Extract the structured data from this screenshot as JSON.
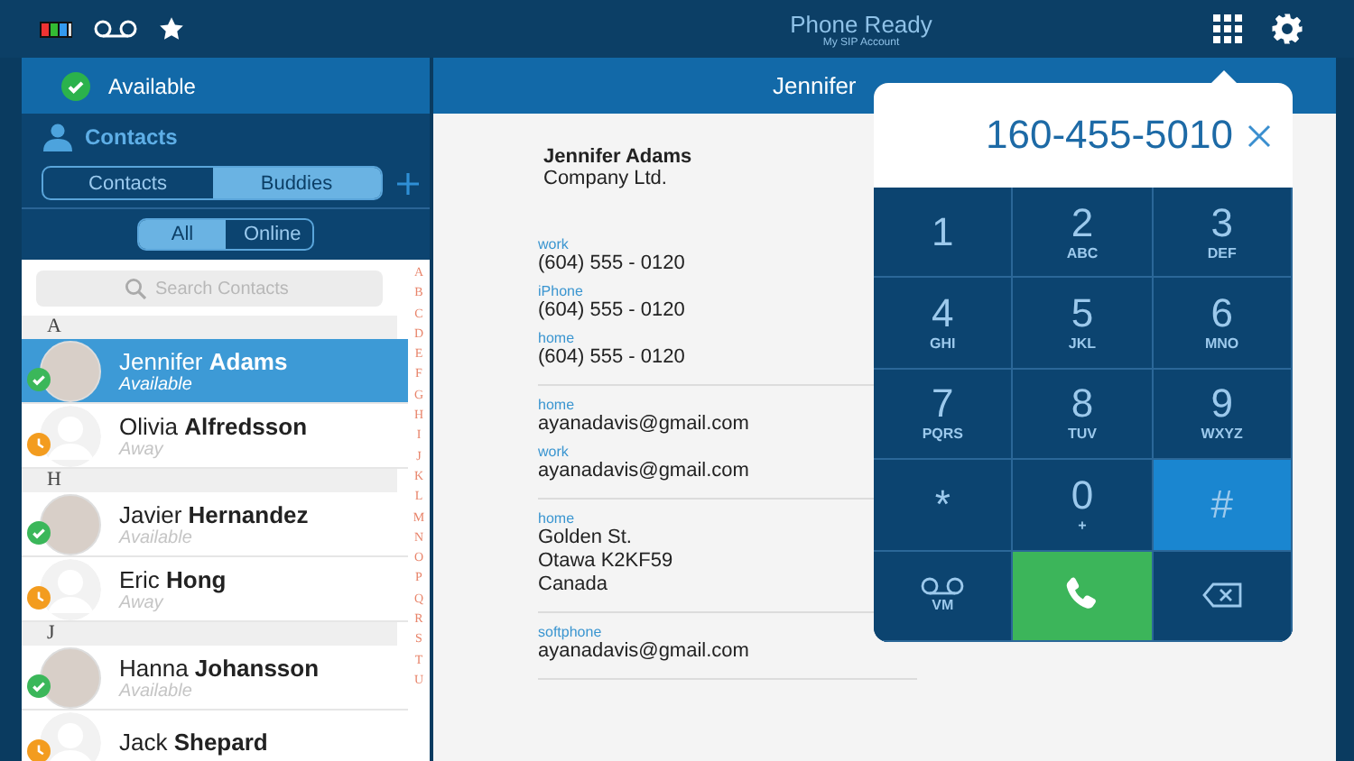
{
  "top_bar": {
    "title": "Phone Ready",
    "subtitle": "My SIP Account"
  },
  "presence": {
    "label": "Available",
    "online": true
  },
  "sidebar": {
    "heading": "Contacts",
    "source_tabs": [
      {
        "label": "Contacts",
        "selected": false
      },
      {
        "label": "Buddies",
        "selected": true
      }
    ],
    "filter_tabs": [
      {
        "label": "All",
        "selected": true
      },
      {
        "label": "Online",
        "selected": false
      }
    ],
    "search": {
      "placeholder": "Search Contacts"
    },
    "sections": [
      {
        "letter": "A",
        "contacts": [
          {
            "first": "Jennifer",
            "last": "Adams",
            "status": "Available",
            "online": true,
            "has_photo": true,
            "selected": true
          },
          {
            "first": "Olivia",
            "last": "Alfredsson",
            "status": "Away",
            "online": false,
            "has_photo": false,
            "selected": false
          }
        ]
      },
      {
        "letter": "H",
        "contacts": [
          {
            "first": "Javier",
            "last": "Hernandez",
            "status": "Available",
            "online": true,
            "has_photo": true,
            "selected": false
          },
          {
            "first": "Eric",
            "last": "Hong",
            "status": "Away",
            "online": false,
            "has_photo": false,
            "selected": false
          }
        ]
      },
      {
        "letter": "J",
        "contacts": [
          {
            "first": "Hanna",
            "last": "Johansson",
            "status": "Available",
            "online": true,
            "has_photo": true,
            "selected": false
          },
          {
            "first": "Jack",
            "last": "Shepard",
            "online": false,
            "has_photo": false,
            "selected": false
          }
        ]
      }
    ],
    "index": [
      "A",
      "B",
      "C",
      "D",
      "E",
      "F",
      "G",
      "H",
      "I",
      "J",
      "K",
      "L",
      "M",
      "N",
      "O",
      "P",
      "Q",
      "R",
      "S",
      "T",
      "U"
    ]
  },
  "detail": {
    "header": "Jennifer",
    "name": "Jennifer Adams",
    "company": "Company Ltd.",
    "groups": [
      {
        "fields": [
          {
            "label": "work",
            "lines": [
              "(604) 555 - 0120"
            ]
          },
          {
            "label": "iPhone",
            "lines": [
              "(604) 555 - 0120"
            ]
          },
          {
            "label": "home",
            "lines": [
              "(604) 555 - 0120"
            ]
          }
        ]
      },
      {
        "fields": [
          {
            "label": "home",
            "lines": [
              "ayanadavis@gmail.com"
            ]
          },
          {
            "label": "work",
            "lines": [
              "ayanadavis@gmail.com"
            ]
          }
        ]
      },
      {
        "fields": [
          {
            "label": "home",
            "lines": [
              "Golden St.",
              "Otawa K2KF59",
              "Canada"
            ]
          }
        ]
      },
      {
        "fields": [
          {
            "label": "softphone",
            "lines": [
              "ayanadavis@gmail.com"
            ]
          }
        ]
      }
    ]
  },
  "dialpad": {
    "number": "160-455-5010",
    "keys": [
      {
        "kind": "digit",
        "digit": "1",
        "selected": false
      },
      {
        "kind": "digit",
        "digit": "2",
        "letters": "ABC",
        "selected": false
      },
      {
        "kind": "digit",
        "digit": "3",
        "letters": "DEF",
        "selected": false
      },
      {
        "kind": "digit",
        "digit": "4",
        "letters": "GHI",
        "selected": false
      },
      {
        "kind": "digit",
        "digit": "5",
        "letters": "JKL",
        "selected": false
      },
      {
        "kind": "digit",
        "digit": "6",
        "letters": "MNO",
        "selected": false
      },
      {
        "kind": "digit",
        "digit": "7",
        "letters": "PQRS",
        "selected": false
      },
      {
        "kind": "digit",
        "digit": "8",
        "letters": "TUV",
        "selected": false
      },
      {
        "kind": "digit",
        "digit": "9",
        "letters": "WXYZ",
        "selected": false
      },
      {
        "kind": "digit",
        "digit": "*",
        "selected": false
      },
      {
        "kind": "digit",
        "digit": "0",
        "letters": "+",
        "selected": false
      },
      {
        "kind": "digit",
        "digit": "#",
        "selected": true
      },
      {
        "kind": "voicemail",
        "letters": "VM",
        "selected": false
      },
      {
        "kind": "call",
        "selected": false
      },
      {
        "kind": "backspace",
        "selected": false
      }
    ]
  }
}
